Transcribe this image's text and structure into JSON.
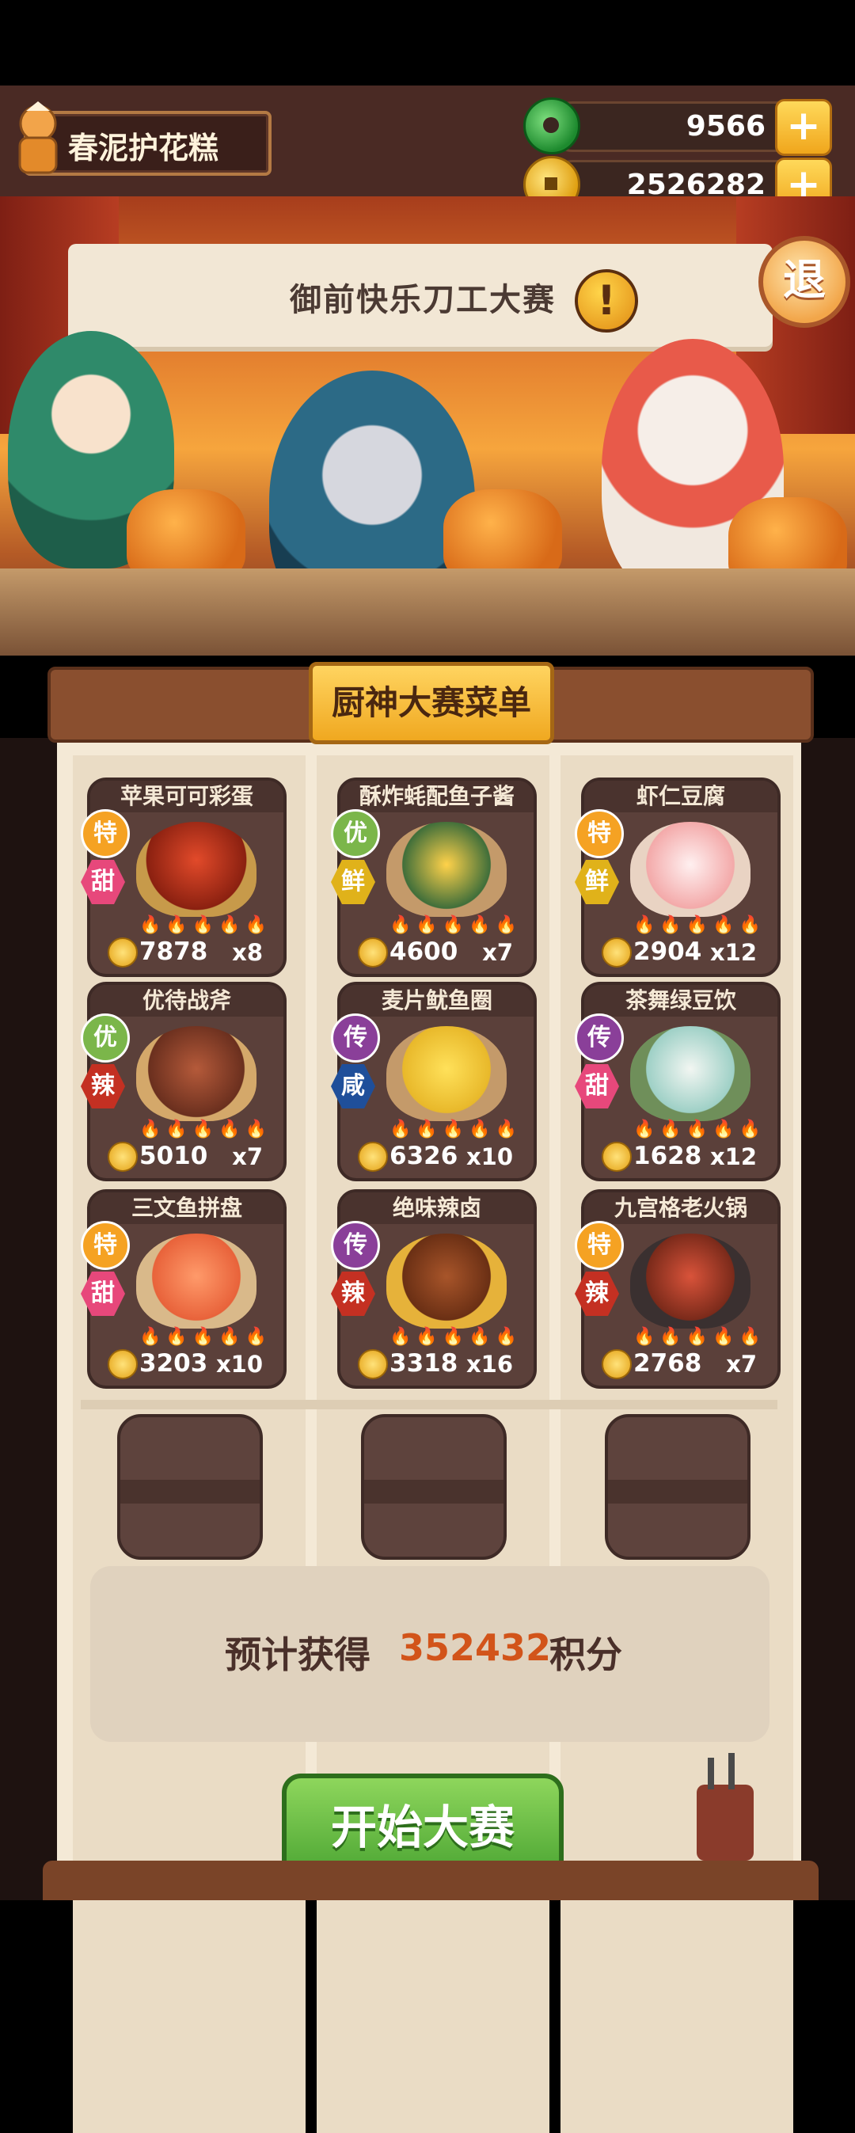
{
  "player": {
    "name": "春泥护花糕"
  },
  "currency": {
    "jade": {
      "value": "9566",
      "icon": "jade-currency-icon"
    },
    "gold": {
      "value": "2526282",
      "icon": "gold-coin-icon"
    },
    "plus": "+"
  },
  "stage": {
    "banner_title": "御前快乐刀工大赛",
    "alert_symbol": "!",
    "exit_label": "退"
  },
  "menu": {
    "title": "厨神大赛菜单",
    "coin_icon": "coin-icon",
    "dishes": [
      {
        "name": "苹果可可彩蛋",
        "grade": "特",
        "taste": "甜",
        "price": "7878",
        "qty": "x8",
        "flames": "🔥🔥🔥🔥🔥"
      },
      {
        "name": "酥炸蚝配鱼子酱",
        "grade": "优",
        "taste": "鲜",
        "price": "4600",
        "qty": "x7",
        "flames": "🔥🔥🔥🔥🔥"
      },
      {
        "name": "虾仁豆腐",
        "grade": "特",
        "taste": "鲜",
        "price": "2904",
        "qty": "x12",
        "flames": "🔥🔥🔥🔥🔥"
      },
      {
        "name": "优待战斧",
        "grade": "优",
        "taste": "辣",
        "price": "5010",
        "qty": "x7",
        "flames": "🔥🔥🔥🔥🔥"
      },
      {
        "name": "麦片鱿鱼圈",
        "grade": "传",
        "taste": "咸",
        "price": "6326",
        "qty": "x10",
        "flames": "🔥🔥🔥🔥🔥"
      },
      {
        "name": "茶舞绿豆饮",
        "grade": "传",
        "taste": "甜",
        "price": "1628",
        "qty": "x12",
        "flames": "🔥🔥🔥🔥🔥"
      },
      {
        "name": "三文鱼拼盘",
        "grade": "特",
        "taste": "甜",
        "price": "3203",
        "qty": "x10",
        "flames": "🔥🔥🔥🔥🔥"
      },
      {
        "name": "绝味辣卤",
        "grade": "传",
        "taste": "辣",
        "price": "3318",
        "qty": "x16",
        "flames": "🔥🔥🔥🔥🔥"
      },
      {
        "name": "九宫格老火锅",
        "grade": "特",
        "taste": "辣",
        "price": "2768",
        "qty": "x7",
        "flames": "🔥🔥🔥🔥🔥"
      }
    ]
  },
  "estimate": {
    "prefix": "预计获得",
    "points": "352432",
    "suffix": "积分"
  },
  "start_button": "开始大赛"
}
